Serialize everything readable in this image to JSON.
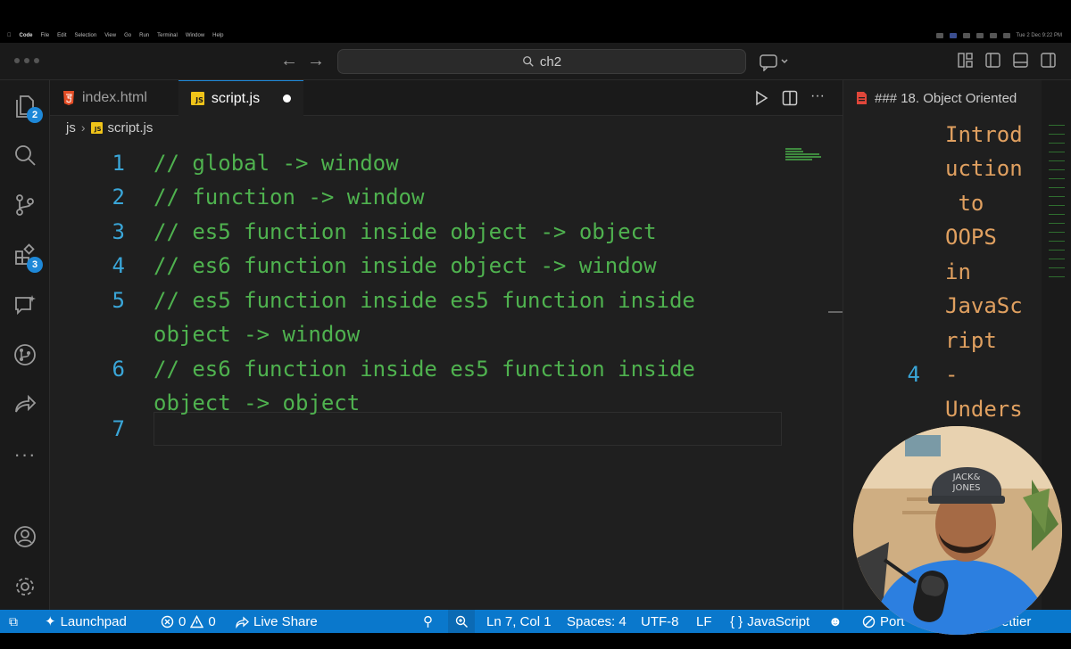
{
  "menubar": {
    "items": [
      "Code",
      "File",
      "Edit",
      "Selection",
      "View",
      "Go",
      "Run",
      "Terminal",
      "Window",
      "Help"
    ],
    "clock": "Tue 2 Dec  9:22 PM"
  },
  "titlebar": {
    "search_text": "ch2"
  },
  "activity": {
    "explorer_badge": "2",
    "extensions_badge": "3"
  },
  "tabs": [
    {
      "label": "index.html"
    },
    {
      "label": "script.js"
    }
  ],
  "breadcrumb": {
    "folder": "js",
    "file": "script.js"
  },
  "editor": {
    "lines": [
      {
        "num": "1",
        "text": "// global -> window"
      },
      {
        "num": "2",
        "text": "// function -> window"
      },
      {
        "num": "3",
        "text": "// es5 function inside object -> object"
      },
      {
        "num": "4",
        "text": "// es6 function inside object -> window"
      },
      {
        "num": "5",
        "text": "// es5 function inside es5 function inside",
        "cont": "object -> window"
      },
      {
        "num": "6",
        "text": "// es6 function inside es5 function inside",
        "cont": "object -> object"
      },
      {
        "num": "7",
        "text": ""
      }
    ]
  },
  "preview": {
    "tab_label": "### 18. Object Oriented",
    "lines": [
      "Introd",
      "uction",
      " to",
      "OOPS",
      "in",
      "JavaSc",
      "ript",
      "-",
      "Unders"
    ],
    "line_number": "4"
  },
  "statusbar": {
    "launchpad": "Launchpad",
    "errors": "0",
    "warnings": "0",
    "liveshare": "Live Share",
    "position": "Ln 7, Col 1",
    "spaces": "Spaces: 4",
    "encoding": "UTF-8",
    "eol": "LF",
    "language": "JavaScript",
    "port": "Port",
    "prettier": "ettier"
  },
  "colors": {
    "comment_green": "#4fb24f",
    "line_number_blue": "#3aa6d8",
    "statusbar_blue": "#0a78cc",
    "markdown_orange": "#e0a060"
  }
}
